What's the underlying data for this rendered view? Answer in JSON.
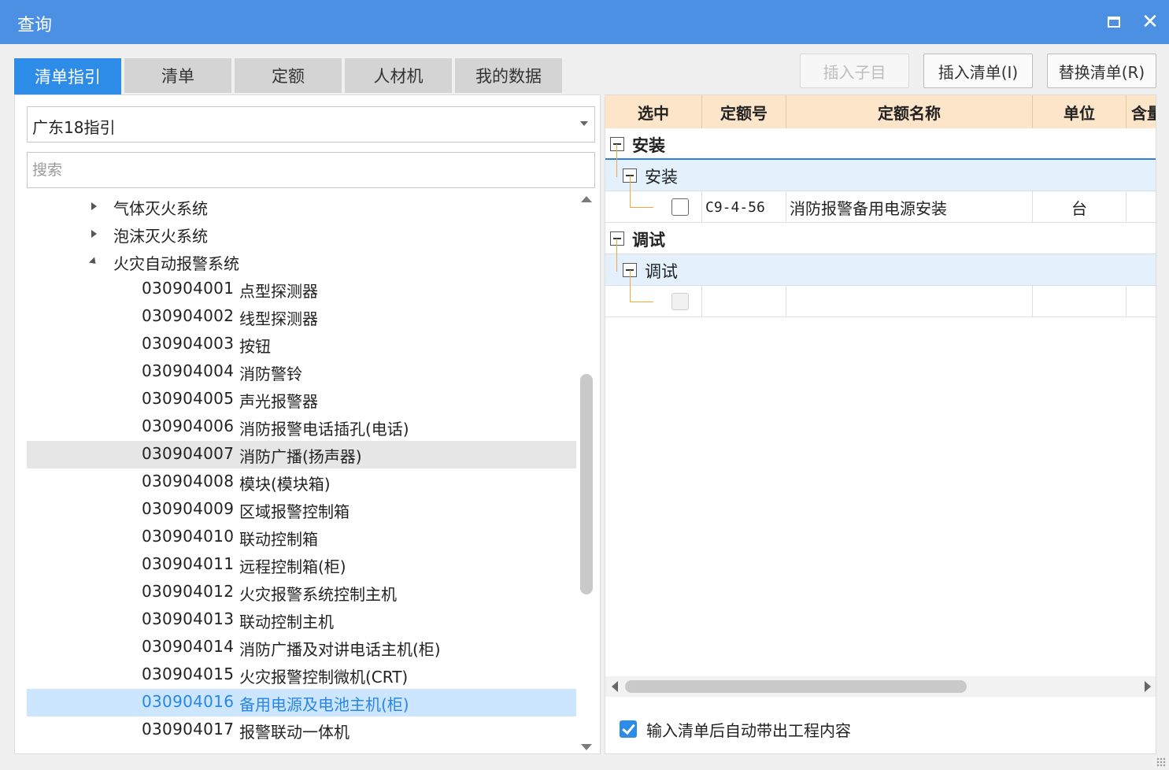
{
  "window": {
    "title": "查询"
  },
  "tabs": [
    {
      "label": "清单指引",
      "active": true
    },
    {
      "label": "清单",
      "active": false
    },
    {
      "label": "定额",
      "active": false
    },
    {
      "label": "人材机",
      "active": false
    },
    {
      "label": "我的数据",
      "active": false
    }
  ],
  "toolbar": {
    "insert_sub": "插入子目",
    "insert_list": "插入清单(I)",
    "replace_list": "替换清单(R)"
  },
  "left": {
    "guide_select": "广东18指引",
    "search_placeholder": "搜索",
    "categories": [
      {
        "label": "气体灭火系统",
        "expanded": false
      },
      {
        "label": "泡沫灭火系统",
        "expanded": false
      },
      {
        "label": "火灾自动报警系统",
        "expanded": true
      }
    ],
    "items": [
      {
        "code": "030904001",
        "name": "点型探测器"
      },
      {
        "code": "030904002",
        "name": "线型探测器"
      },
      {
        "code": "030904003",
        "name": "按钮"
      },
      {
        "code": "030904004",
        "name": "消防警铃"
      },
      {
        "code": "030904005",
        "name": "声光报警器"
      },
      {
        "code": "030904006",
        "name": "消防报警电话插孔(电话)"
      },
      {
        "code": "030904007",
        "name": "消防广播(扬声器)"
      },
      {
        "code": "030904008",
        "name": "模块(模块箱)"
      },
      {
        "code": "030904009",
        "name": "区域报警控制箱"
      },
      {
        "code": "030904010",
        "name": "联动控制箱"
      },
      {
        "code": "030904011",
        "name": "远程控制箱(柜)"
      },
      {
        "code": "030904012",
        "name": "火灾报警系统控制主机"
      },
      {
        "code": "030904013",
        "name": "联动控制主机"
      },
      {
        "code": "030904014",
        "name": "消防广播及对讲电话主机(柜)"
      },
      {
        "code": "030904015",
        "name": "火灾报警控制微机(CRT)"
      },
      {
        "code": "030904016",
        "name": "备用电源及电池主机(柜)"
      },
      {
        "code": "030904017",
        "name": "报警联动一体机"
      }
    ],
    "hover_code": "030904007",
    "selected_code": "030904016"
  },
  "grid": {
    "columns": [
      "选中",
      "定额号",
      "定额名称",
      "单位",
      "含量"
    ],
    "groups": [
      {
        "label": "安装",
        "sub": {
          "label": "安装",
          "rows": [
            {
              "checked": false,
              "code": "C9-4-56",
              "name": "消防报警备用电源安装",
              "unit": "台"
            }
          ]
        }
      },
      {
        "label": "调试",
        "sub": {
          "label": "调试",
          "rows": [
            {
              "checked": false,
              "code": "",
              "name": "",
              "unit": ""
            }
          ]
        }
      }
    ]
  },
  "footer": {
    "auto_option_label": "输入清单后自动带出工程内容",
    "auto_option_checked": true
  },
  "colors": {
    "titlebar": "#4b90e3",
    "tab_active": "#2e8ce9",
    "grid_header": "#fde5c9",
    "selection": "#cce6ff"
  }
}
